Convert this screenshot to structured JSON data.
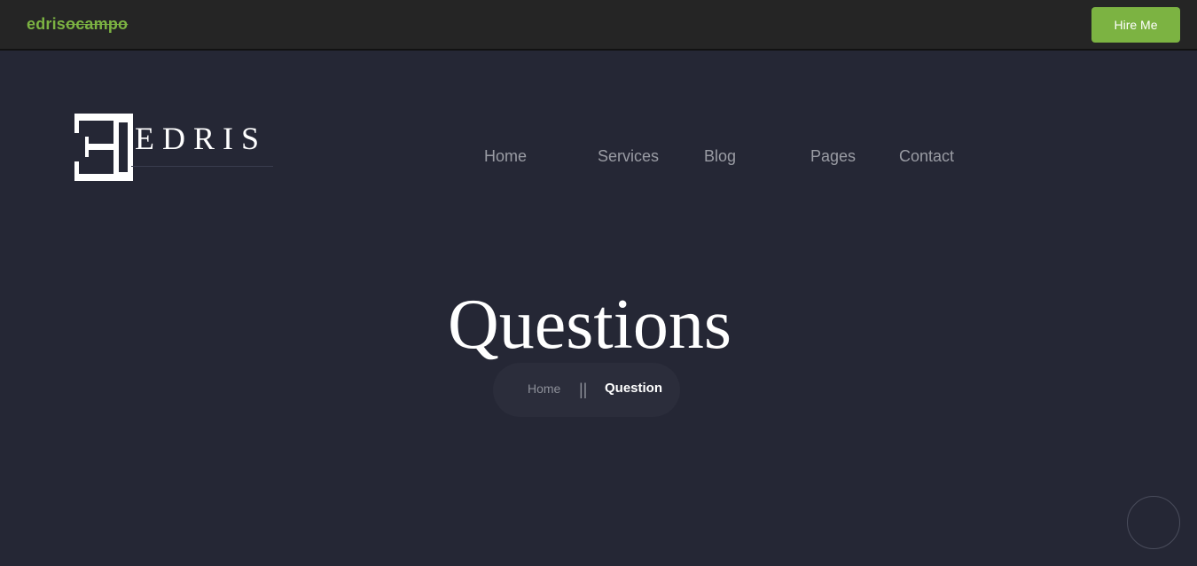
{
  "topbar": {
    "brand_main": "edris",
    "brand_struck": "ocampo",
    "hire_button": "Hire Me",
    "accent_color": "#7cb342"
  },
  "logo": {
    "mark_letter": "E",
    "word": "EDRIS"
  },
  "nav": {
    "items": [
      {
        "label": "Home"
      },
      {
        "label": "Services"
      },
      {
        "label": "Blog"
      },
      {
        "label": "Pages"
      },
      {
        "label": "Contact"
      }
    ]
  },
  "hero": {
    "title": "Questions"
  },
  "breadcrumb": {
    "home": "Home",
    "separator": "||",
    "current": "Question"
  },
  "scroll_top": {
    "icon": "scroll-to-top-ring-icon"
  }
}
